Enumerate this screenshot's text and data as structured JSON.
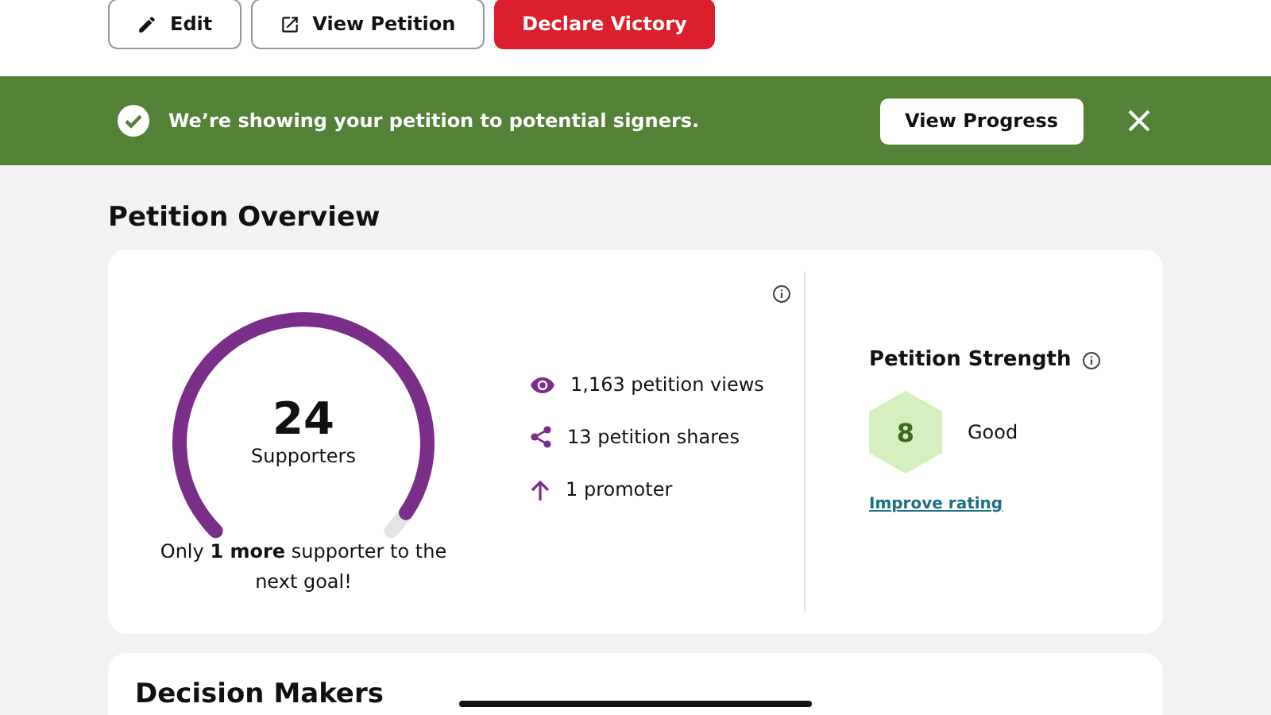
{
  "actions": [
    {
      "kind": "edit",
      "label": "Edit"
    },
    {
      "kind": "external",
      "label": "View Petition"
    },
    {
      "kind": "primary",
      "label": "Declare Victory"
    }
  ],
  "banner": {
    "message": "We’re showing your petition to potential signers.",
    "button": "View Progress"
  },
  "overview": {
    "title": "Petition Overview",
    "gauge": {
      "count": "24",
      "label": "Supporters",
      "level": 0.96,
      "note": "Only **1 more** supporter to the next goal!"
    },
    "stats": [
      {
        "kind": "views",
        "text": "1,163 petition views"
      },
      {
        "kind": "shares",
        "text": "13 petition shares"
      },
      {
        "kind": "promoters",
        "text": "1 promoter"
      }
    ],
    "strength": {
      "title": "Petition Strength",
      "score": "8",
      "rating": "Good",
      "link": "Improve rating"
    }
  },
  "next_section": {
    "title": "Decision Makers"
  }
}
